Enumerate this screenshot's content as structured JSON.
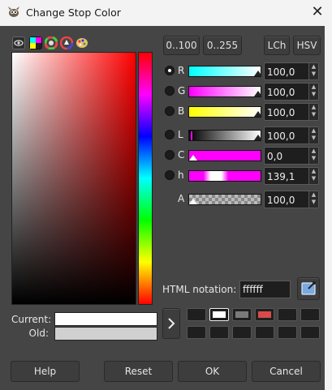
{
  "window": {
    "title": "Change Stop Color",
    "close_icon": "✕"
  },
  "tabs": [
    {
      "name": "gimp-selector",
      "icon": "eye-icon"
    },
    {
      "name": "cmyk-selector",
      "icon": "cmyk-icon"
    },
    {
      "name": "wheel-selector",
      "icon": "color-wheel-icon"
    },
    {
      "name": "triangle-selector",
      "icon": "triangle-icon"
    },
    {
      "name": "palette-selector",
      "icon": "palette-icon"
    }
  ],
  "range_buttons": {
    "range_100": "0..100",
    "range_255": "0..255",
    "lch": "LCh",
    "hsv": "HSV"
  },
  "channels": [
    {
      "label": "R",
      "value": "100,0",
      "selected": true
    },
    {
      "label": "G",
      "value": "100,0",
      "selected": false
    },
    {
      "label": "B",
      "value": "100,0",
      "selected": false
    },
    {
      "label": "L",
      "value": "100,0",
      "selected": false
    },
    {
      "label": "C",
      "value": "0,0",
      "selected": false
    },
    {
      "label": "h",
      "value": "139,1",
      "selected": false
    },
    {
      "label": "A",
      "value": "100,0"
    }
  ],
  "html_notation": {
    "label": "HTML notation:",
    "value": "ffffff"
  },
  "compare": {
    "current_label": "Current:",
    "old_label": "Old:",
    "current_color": "#ffffff",
    "old_color": "#d0d0d0"
  },
  "history": {
    "row1": [
      "#1f1f1f",
      "#ffffff",
      "#7a7a7a",
      "#d94a4a",
      "#1f1f1f",
      "#1f1f1f"
    ],
    "row2": [
      "#1f1f1f",
      "#1f1f1f",
      "#1f1f1f",
      "#1f1f1f",
      "#1f1f1f",
      "#1f1f1f"
    ]
  },
  "buttons": {
    "help": "Help",
    "reset": "Reset",
    "ok": "OK",
    "cancel": "Cancel"
  }
}
